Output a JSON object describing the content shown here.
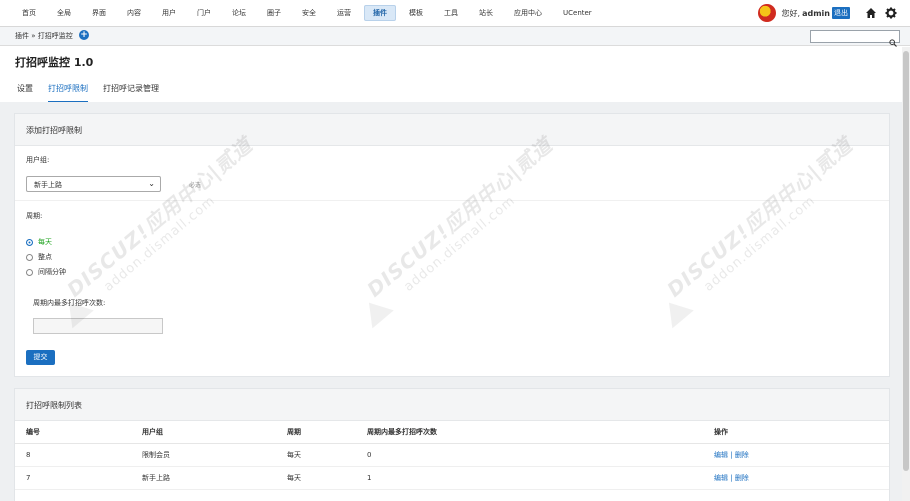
{
  "nav": {
    "items": [
      {
        "label": "首页",
        "active": false
      },
      {
        "label": "全局",
        "active": false
      },
      {
        "label": "界面",
        "active": false
      },
      {
        "label": "内容",
        "active": false
      },
      {
        "label": "用户",
        "active": false
      },
      {
        "label": "门户",
        "active": false
      },
      {
        "label": "论坛",
        "active": false
      },
      {
        "label": "圈子",
        "active": false
      },
      {
        "label": "安全",
        "active": false
      },
      {
        "label": "运营",
        "active": false
      },
      {
        "label": "插件",
        "active": true
      },
      {
        "label": "模板",
        "active": false
      },
      {
        "label": "工具",
        "active": false
      },
      {
        "label": "站长",
        "active": false
      },
      {
        "label": "应用中心",
        "active": false
      },
      {
        "label": "UCenter",
        "active": false
      }
    ],
    "greeting": "您好,",
    "username": "admin",
    "logout": "退出",
    "icons": [
      "app-logo-icon",
      "home-icon",
      "gear-icon"
    ]
  },
  "breadcrumb": "插件 » 打招呼监控",
  "page": {
    "title": "打招呼监控 1.0",
    "tabs": [
      {
        "label": "设置",
        "active": false
      },
      {
        "label": "打招呼限制",
        "active": true
      },
      {
        "label": "打招呼记录管理",
        "active": false
      }
    ]
  },
  "form": {
    "header": "添加打招呼限制",
    "group_label": "用户组:",
    "group_selected": "新手上路",
    "group_hint": "必选",
    "period_label": "周期:",
    "period_options": [
      {
        "label": "每天",
        "selected": true
      },
      {
        "label": "整点",
        "selected": false
      },
      {
        "label": "间隔分钟",
        "selected": false
      }
    ],
    "count_label": "周期内最多打招呼次数:",
    "count_value": "",
    "submit": "提交"
  },
  "list": {
    "header": "打招呼限制列表",
    "columns": [
      "编号",
      "用户组",
      "周期",
      "周期内最多打招呼次数",
      "操作"
    ],
    "rows": [
      {
        "id": "8",
        "group": "限制会员",
        "period": "每天",
        "count": "0",
        "edit": "编辑",
        "sep": " | ",
        "delete": "删除"
      },
      {
        "id": "7",
        "group": "新手上路",
        "period": "每天",
        "count": "1",
        "edit": "编辑",
        "sep": " | ",
        "delete": "删除"
      }
    ]
  },
  "watermark": {
    "line1": "DISCUZ!应用中心|贰道",
    "line2": "addon.dismall.com"
  },
  "colors": {
    "accent": "#1b6fc0",
    "selected_radio_text": "#1fa31f"
  }
}
